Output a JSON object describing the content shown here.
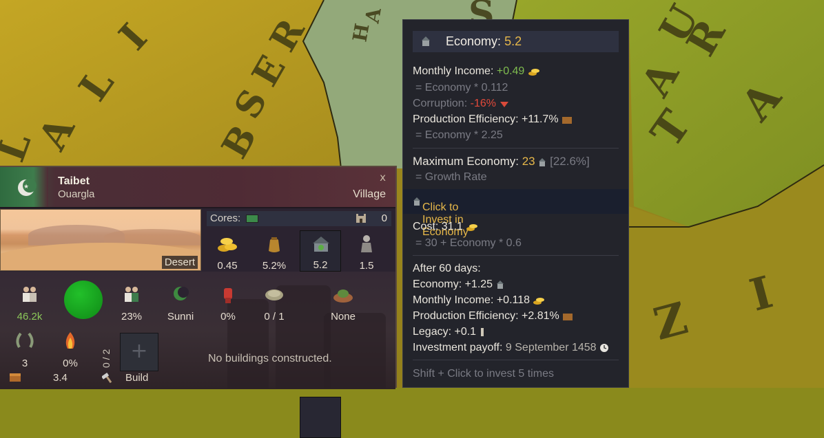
{
  "map": {
    "labels": [
      "L",
      "A",
      "L",
      "I",
      "B",
      "S",
      "E",
      "R",
      "H",
      "A",
      "S",
      "U",
      "A",
      "R",
      "T",
      "A",
      "Z",
      "I",
      "2",
      "/"
    ],
    "colors": {
      "olive": "#8f8a1e",
      "gold": "#b49a1c",
      "green": "#9aa528",
      "teal": "#8faa7a"
    }
  },
  "province": {
    "name": "Taibet",
    "area": "Ouargla",
    "rank": "Village",
    "close": "x",
    "terrain": "Desert",
    "cores_label": "Cores:",
    "fort_value": "0",
    "stats_row1": [
      {
        "icon": "gold-coins-icon",
        "value": "0.45"
      },
      {
        "icon": "money-bag-icon",
        "value": "5.2%"
      },
      {
        "icon": "economy-icon",
        "value": "5.2"
      },
      {
        "icon": "soldier-icon",
        "value": "1.5"
      }
    ],
    "stats_row2": [
      {
        "icon": "population-icon",
        "value": "46.2k"
      },
      {
        "icon": "culture-people-icon",
        "value": "23%"
      },
      {
        "icon": "religion-icon",
        "value": "Sunni"
      },
      {
        "icon": "unrest-fist-icon",
        "value": "0%"
      },
      {
        "icon": "trade-goods-icon",
        "value": "0 / 1"
      },
      {
        "icon": "estate-icon",
        "value": "None"
      }
    ],
    "stats_row3": [
      {
        "icon": "laurel-icon",
        "value": "3"
      },
      {
        "icon": "devastation-fire-icon",
        "value": "0%"
      }
    ],
    "slots": "0 / 2",
    "no_buildings": "No buildings constructed.",
    "bottom_value": "3.4",
    "build_label": "Build",
    "build_plus": "+"
  },
  "tooltip": {
    "title_label": "Economy:",
    "title_value": "5.2",
    "monthly_income_label": "Monthly Income:",
    "monthly_income_value": "+0.49",
    "monthly_income_formula": "= Economy * 0.112",
    "corruption_label": "Corruption:",
    "corruption_value": "-16%",
    "production_label": "Production Efficiency:",
    "production_value": "+11.7%",
    "production_formula": "= Economy * 2.25",
    "max_economy_label": "Maximum Economy:",
    "max_economy_value": "23",
    "max_economy_pct": "[22.6%]",
    "growth_rate": "= Growth Rate",
    "invest_label": "Click to Invest in Economy",
    "cost_label": "Cost:",
    "cost_value": "31.1",
    "cost_formula": "= 30 + Economy * 0.6",
    "after_label": "After 60 days:",
    "after_economy": "Economy: +1.25",
    "after_income": "Monthly Income: +0.118",
    "after_production": "Production Efficiency: +2.81%",
    "after_legacy": "Legacy: +0.1",
    "payoff_label": "Investment payoff:",
    "payoff_value": "9 September 1458",
    "shift_hint": "Shift + Click to invest 5 times"
  }
}
